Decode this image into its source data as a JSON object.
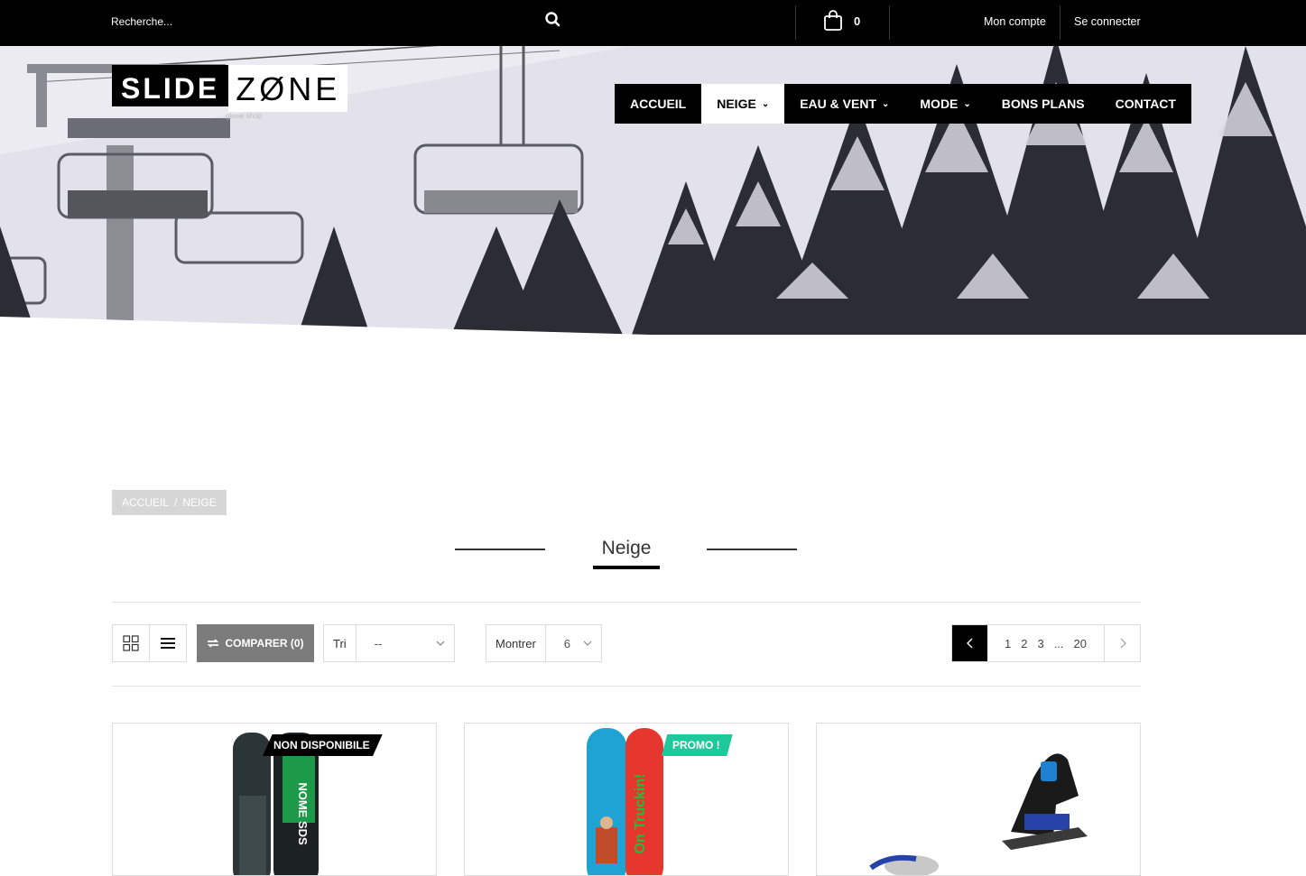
{
  "topbar": {
    "search_placeholder": "Recherche...",
    "cart_count": "0",
    "account_label": "Mon compte",
    "login_label": "Se connecter"
  },
  "logo": {
    "part1": "SLIDE",
    "part2": "ZØNE",
    "tagline": "glisse shop"
  },
  "nav": [
    {
      "label": "ACCUEIL",
      "dropdown": false,
      "active": false
    },
    {
      "label": "NEIGE",
      "dropdown": true,
      "active": true
    },
    {
      "label": "EAU & VENT",
      "dropdown": true,
      "active": false
    },
    {
      "label": "MODE",
      "dropdown": true,
      "active": false
    },
    {
      "label": "BONS PLANS",
      "dropdown": false,
      "active": false
    },
    {
      "label": "CONTACT",
      "dropdown": false,
      "active": false
    }
  ],
  "breadcrumb": {
    "home": "ACCUEIL",
    "sep": "/",
    "current": "NEIGE"
  },
  "page_title": "Neige",
  "toolbar": {
    "compare_label": "COMPARER (0)",
    "sort_label": "Tri",
    "sort_value": "--",
    "show_label": "Montrer",
    "show_value": "6"
  },
  "pagination": {
    "pages": [
      "1",
      "2",
      "3"
    ],
    "ellipsis": "...",
    "last": "20"
  },
  "products": [
    {
      "badge": "NON DISPONIBILE",
      "badge_color": "#000000",
      "board_text": "NOME SDS"
    },
    {
      "badge": "PROMO !",
      "badge_color": "#1fc89a",
      "board_text": "On Truckin!"
    },
    {
      "badge": "",
      "badge_color": "",
      "board_text": ""
    }
  ],
  "colors": {
    "topbar": "#000000",
    "accent_promo": "#1fc89a",
    "compare_bg": "#7b7b7b",
    "breadcrumb_bg": "#d6d6d6"
  }
}
